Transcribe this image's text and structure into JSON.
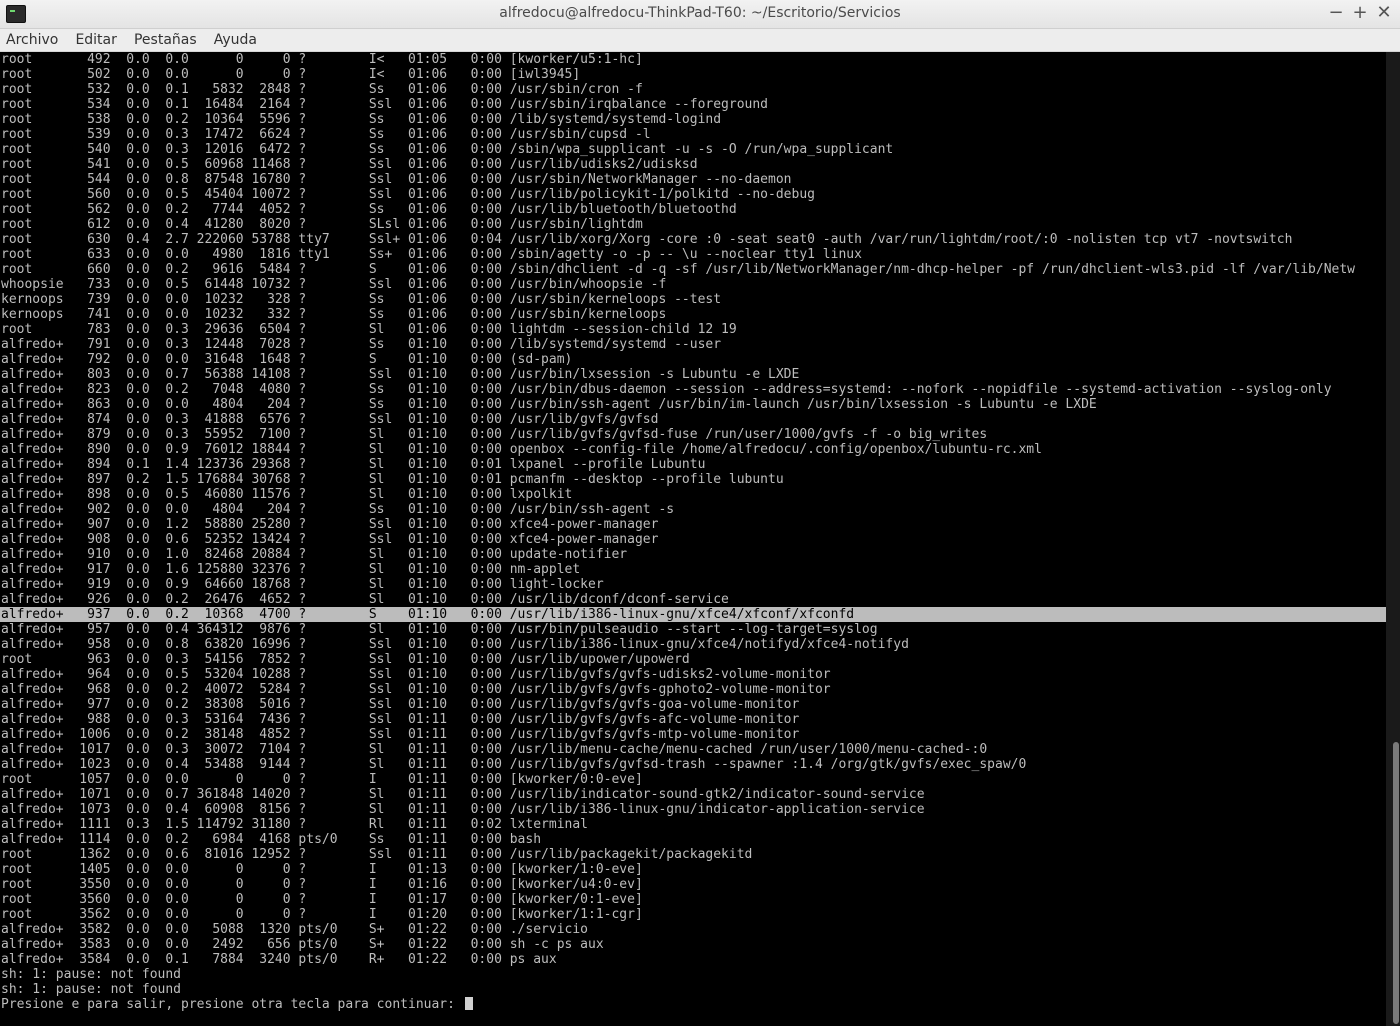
{
  "window": {
    "title": "alfredocu@alfredocu-ThinkPad-T60: ~/Escritorio/Servicios",
    "buttons": {
      "minimize": "−",
      "maximize": "+",
      "close": "✕"
    }
  },
  "menu": [
    "Archivo",
    "Editar",
    "Pestañas",
    "Ayuda"
  ],
  "terminal": {
    "highlight_index": 37,
    "lines": [
      "root       492  0.0  0.0      0     0 ?        I<   01:05   0:00 [kworker/u5:1-hc]",
      "root       502  0.0  0.0      0     0 ?        I<   01:06   0:00 [iwl3945]",
      "root       532  0.0  0.1   5832  2848 ?        Ss   01:06   0:00 /usr/sbin/cron -f",
      "root       534  0.0  0.1  16484  2164 ?        Ssl  01:06   0:00 /usr/sbin/irqbalance --foreground",
      "root       538  0.0  0.2  10364  5596 ?        Ss   01:06   0:00 /lib/systemd/systemd-logind",
      "root       539  0.0  0.3  17472  6624 ?        Ss   01:06   0:00 /usr/sbin/cupsd -l",
      "root       540  0.0  0.3  12016  6472 ?        Ss   01:06   0:00 /sbin/wpa_supplicant -u -s -O /run/wpa_supplicant",
      "root       541  0.0  0.5  60968 11468 ?        Ssl  01:06   0:00 /usr/lib/udisks2/udisksd",
      "root       544  0.0  0.8  87548 16780 ?        Ssl  01:06   0:00 /usr/sbin/NetworkManager --no-daemon",
      "root       560  0.0  0.5  45404 10072 ?        Ssl  01:06   0:00 /usr/lib/policykit-1/polkitd --no-debug",
      "root       562  0.0  0.2   7744  4052 ?        Ss   01:06   0:00 /usr/lib/bluetooth/bluetoothd",
      "root       612  0.0  0.4  41280  8020 ?        SLsl 01:06   0:00 /usr/sbin/lightdm",
      "root       630  0.4  2.7 222060 53788 tty7     Ssl+ 01:06   0:04 /usr/lib/xorg/Xorg -core :0 -seat seat0 -auth /var/run/lightdm/root/:0 -nolisten tcp vt7 -novtswitch",
      "root       633  0.0  0.0   4980  1816 tty1     Ss+  01:06   0:00 /sbin/agetty -o -p -- \\u --noclear tty1 linux",
      "root       660  0.0  0.2   9616  5484 ?        S    01:06   0:00 /sbin/dhclient -d -q -sf /usr/lib/NetworkManager/nm-dhcp-helper -pf /run/dhclient-wls3.pid -lf /var/lib/Netw",
      "whoopsie   733  0.0  0.5  61448 10732 ?        Ssl  01:06   0:00 /usr/bin/whoopsie -f",
      "kernoops   739  0.0  0.0  10232   328 ?        Ss   01:06   0:00 /usr/sbin/kerneloops --test",
      "kernoops   741  0.0  0.0  10232   332 ?        Ss   01:06   0:00 /usr/sbin/kerneloops",
      "root       783  0.0  0.3  29636  6504 ?        Sl   01:06   0:00 lightdm --session-child 12 19",
      "alfredo+   791  0.0  0.3  12448  7028 ?        Ss   01:10   0:00 /lib/systemd/systemd --user",
      "alfredo+   792  0.0  0.0  31648  1648 ?        S    01:10   0:00 (sd-pam)",
      "alfredo+   803  0.0  0.7  56388 14108 ?        Ssl  01:10   0:00 /usr/bin/lxsession -s Lubuntu -e LXDE",
      "alfredo+   823  0.0  0.2   7048  4080 ?        Ss   01:10   0:00 /usr/bin/dbus-daemon --session --address=systemd: --nofork --nopidfile --systemd-activation --syslog-only",
      "alfredo+   863  0.0  0.0   4804   204 ?        Ss   01:10   0:00 /usr/bin/ssh-agent /usr/bin/im-launch /usr/bin/lxsession -s Lubuntu -e LXDE",
      "alfredo+   874  0.0  0.3  41888  6576 ?        Ssl  01:10   0:00 /usr/lib/gvfs/gvfsd",
      "alfredo+   879  0.0  0.3  55952  7100 ?        Sl   01:10   0:00 /usr/lib/gvfs/gvfsd-fuse /run/user/1000/gvfs -f -o big_writes",
      "alfredo+   890  0.0  0.9  76012 18844 ?        Sl   01:10   0:00 openbox --config-file /home/alfredocu/.config/openbox/lubuntu-rc.xml",
      "alfredo+   894  0.1  1.4 123736 29368 ?        Sl   01:10   0:01 lxpanel --profile Lubuntu",
      "alfredo+   897  0.2  1.5 176884 30768 ?        Sl   01:10   0:01 pcmanfm --desktop --profile lubuntu",
      "alfredo+   898  0.0  0.5  46080 11576 ?        Sl   01:10   0:00 lxpolkit",
      "alfredo+   902  0.0  0.0   4804   204 ?        Ss   01:10   0:00 /usr/bin/ssh-agent -s",
      "alfredo+   907  0.0  1.2  58880 25280 ?        Ssl  01:10   0:00 xfce4-power-manager",
      "alfredo+   908  0.0  0.6  52352 13424 ?        Ssl  01:10   0:00 xfce4-power-manager",
      "alfredo+   910  0.0  1.0  82468 20884 ?        Sl   01:10   0:00 update-notifier",
      "alfredo+   917  0.0  1.6 125880 32376 ?        Sl   01:10   0:00 nm-applet",
      "alfredo+   919  0.0  0.9  64660 18768 ?        Sl   01:10   0:00 light-locker",
      "alfredo+   926  0.0  0.2  26476  4652 ?        Sl   01:10   0:00 /usr/lib/dconf/dconf-service",
      "alfredo+   937  0.0  0.2  10368  4700 ?        S    01:10   0:00 /usr/lib/i386-linux-gnu/xfce4/xfconf/xfconfd",
      "alfredo+   957  0.0  0.4 364312  9876 ?        Sl   01:10   0:00 /usr/bin/pulseaudio --start --log-target=syslog",
      "alfredo+   958  0.0  0.8  63820 16996 ?        Ssl  01:10   0:00 /usr/lib/i386-linux-gnu/xfce4/notifyd/xfce4-notifyd",
      "root       963  0.0  0.3  54156  7852 ?        Ssl  01:10   0:00 /usr/lib/upower/upowerd",
      "alfredo+   964  0.0  0.5  53204 10288 ?        Ssl  01:10   0:00 /usr/lib/gvfs/gvfs-udisks2-volume-monitor",
      "alfredo+   968  0.0  0.2  40072  5284 ?        Ssl  01:10   0:00 /usr/lib/gvfs/gvfs-gphoto2-volume-monitor",
      "alfredo+   977  0.0  0.2  38308  5016 ?        Ssl  01:10   0:00 /usr/lib/gvfs/gvfs-goa-volume-monitor",
      "alfredo+   988  0.0  0.3  53164  7436 ?        Ssl  01:11   0:00 /usr/lib/gvfs/gvfs-afc-volume-monitor",
      "alfredo+  1006  0.0  0.2  38148  4852 ?        Ssl  01:11   0:00 /usr/lib/gvfs/gvfs-mtp-volume-monitor",
      "alfredo+  1017  0.0  0.3  30072  7104 ?        Sl   01:11   0:00 /usr/lib/menu-cache/menu-cached /run/user/1000/menu-cached-:0",
      "alfredo+  1023  0.0  0.4  53488  9144 ?        Sl   01:11   0:00 /usr/lib/gvfs/gvfsd-trash --spawner :1.4 /org/gtk/gvfs/exec_spaw/0",
      "root      1057  0.0  0.0      0     0 ?        I    01:11   0:00 [kworker/0:0-eve]",
      "alfredo+  1071  0.0  0.7 361848 14020 ?        Sl   01:11   0:00 /usr/lib/indicator-sound-gtk2/indicator-sound-service",
      "alfredo+  1073  0.0  0.4  60908  8156 ?        Sl   01:11   0:00 /usr/lib/i386-linux-gnu/indicator-application-service",
      "alfredo+  1111  0.3  1.5 114792 31180 ?        Rl   01:11   0:02 lxterminal",
      "alfredo+  1114  0.0  0.2   6984  4168 pts/0    Ss   01:11   0:00 bash",
      "root      1362  0.0  0.6  81016 12952 ?        Ssl  01:11   0:00 /usr/lib/packagekit/packagekitd",
      "root      1405  0.0  0.0      0     0 ?        I    01:13   0:00 [kworker/1:0-eve]",
      "root      3550  0.0  0.0      0     0 ?        I    01:16   0:00 [kworker/u4:0-ev]",
      "root      3560  0.0  0.0      0     0 ?        I    01:17   0:00 [kworker/0:1-eve]",
      "root      3562  0.0  0.0      0     0 ?        I    01:20   0:00 [kworker/1:1-cgr]",
      "alfredo+  3582  0.0  0.0   5088  1320 pts/0    S+   01:22   0:00 ./servicio",
      "alfredo+  3583  0.0  0.0   2492   656 pts/0    S+   01:22   0:00 sh -c ps aux",
      "alfredo+  3584  0.0  0.1   7884  3240 pts/0    R+   01:22   0:00 ps aux",
      "sh: 1: pause: not found",
      "sh: 1: pause: not found"
    ],
    "prompt": "Presione e para salir, presione otra tecla para continuar: "
  }
}
